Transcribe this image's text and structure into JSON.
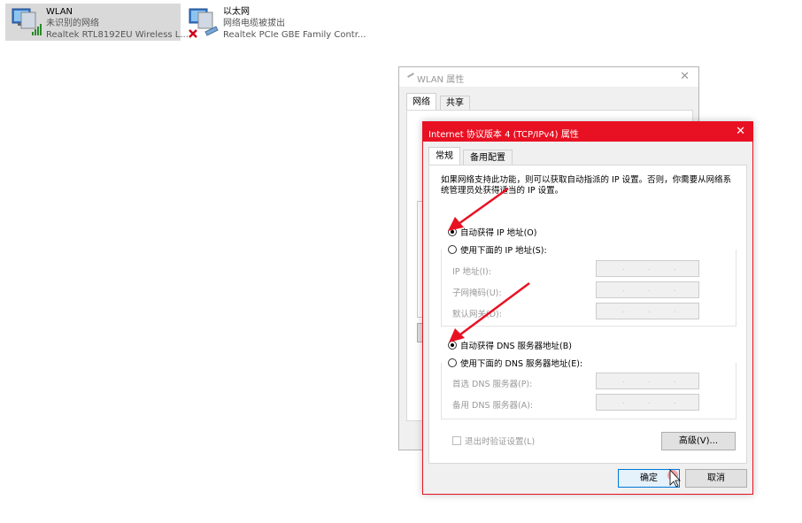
{
  "adapters": [
    {
      "name": "WLAN",
      "status": "未识别的网络",
      "device": "Realtek RTL8192EU Wireless L..."
    },
    {
      "name": "以太网",
      "status": "网络电缆被拔出",
      "device": "Realtek PCIe GBE Family Contr..."
    }
  ],
  "bg_dialog": {
    "title": "WLAN 属性",
    "close": "✕",
    "tabs": [
      "网络",
      "共享"
    ]
  },
  "dialog": {
    "title": "Internet 协议版本 4 (TCP/IPv4) 属性",
    "close": "✕",
    "tabs": [
      "常规",
      "备用配置"
    ],
    "description": "如果网络支持此功能，则可以获取自动指派的 IP 设置。否则，你需要从网络系统管理员处获得适当的 IP 设置。",
    "ip_auto": "自动获得 IP 地址(O)",
    "ip_manual": "使用下面的 IP 地址(S):",
    "ip_fields": [
      "IP 地址(I):",
      "子网掩码(U):",
      "默认网关(D):"
    ],
    "dns_auto": "自动获得 DNS 服务器地址(B)",
    "dns_manual": "使用下面的 DNS 服务器地址(E):",
    "dns_fields": [
      "首选 DNS 服务器(P):",
      "备用 DNS 服务器(A):"
    ],
    "validate": "退出时验证设置(L)",
    "advanced": "高级(V)...",
    "ok": "确定",
    "cancel": "取消",
    "ip_dots": ".",
    "selected_ip_mode": "auto",
    "selected_dns_mode": "auto"
  },
  "colors": {
    "accent": "#e81123",
    "arrow": "#e81123",
    "selection": "#d9d9d9"
  }
}
